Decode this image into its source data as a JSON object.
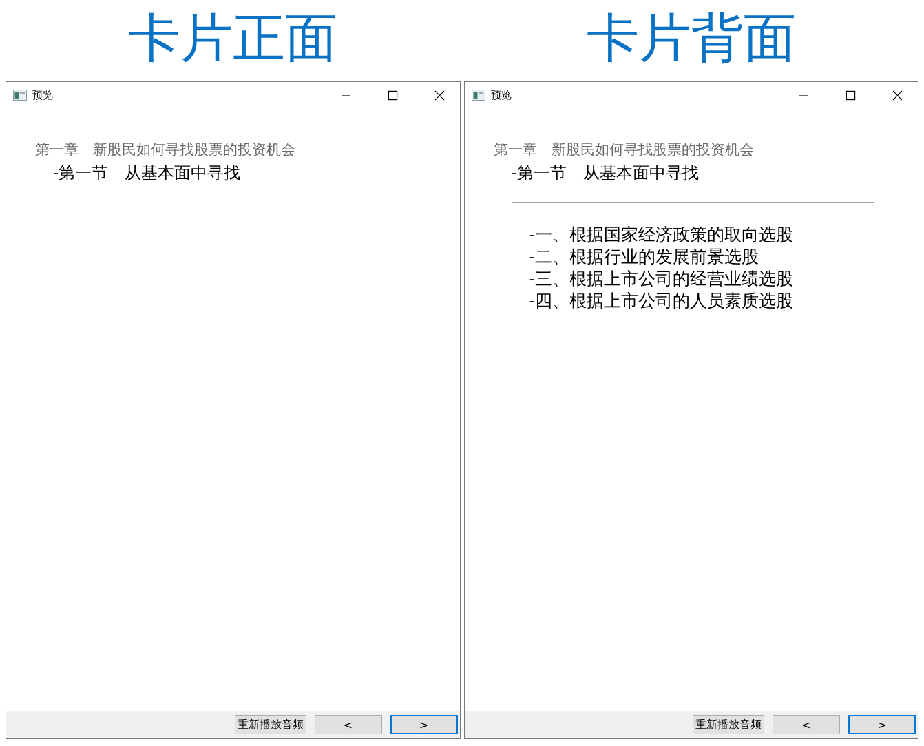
{
  "panels": [
    {
      "heading": "卡片正面",
      "window": {
        "title": "预览"
      },
      "chapter": "第一章　新股民如何寻找股票的投资机会",
      "section": "-第一节　从基本面中寻找",
      "buttons": [
        {
          "label": "重新播放音频",
          "focused": false
        },
        {
          "label": "<",
          "focused": false
        },
        {
          "label": ">",
          "focused": true
        }
      ]
    },
    {
      "heading": "卡片背面",
      "window": {
        "title": "预览"
      },
      "chapter": "第一章　新股民如何寻找股票的投资机会",
      "section": "-第一节　从基本面中寻找",
      "divider": true,
      "items": [
        "-一、根据国家经济政策的取向选股",
        "-二、根据行业的发展前景选股",
        "-三、根据上市公司的经营业绩选股",
        "-四、根据上市公司的人员素质选股"
      ],
      "buttons": [
        {
          "label": "重新播放音频",
          "focused": false
        },
        {
          "label": "<",
          "focused": false
        },
        {
          "label": ">",
          "focused": true
        }
      ]
    }
  ]
}
